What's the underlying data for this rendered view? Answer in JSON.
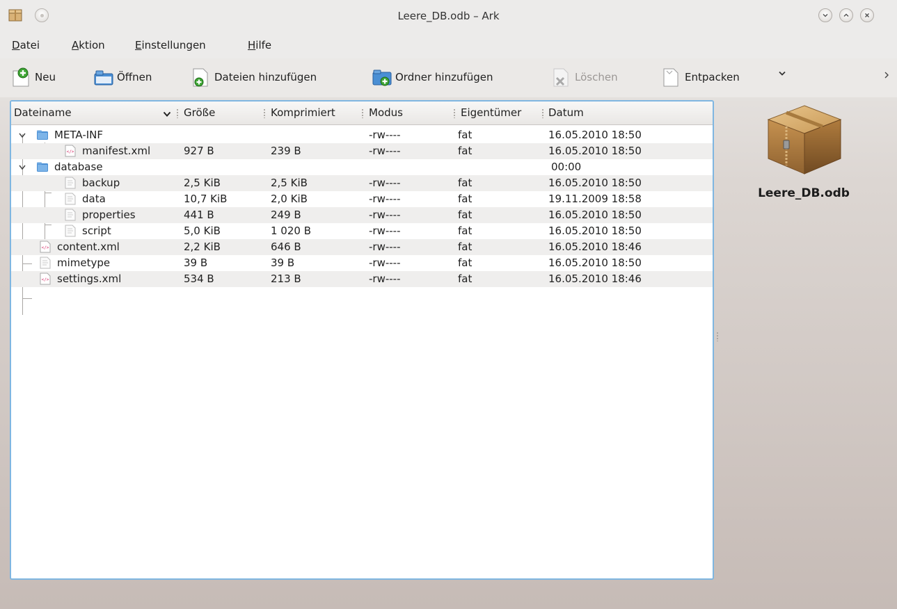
{
  "window": {
    "title": "Leere_DB.odb – Ark",
    "app_icon": "ark-archive-icon",
    "buttons": [
      "minimize-icon",
      "maximize-icon",
      "close-icon"
    ]
  },
  "menu": {
    "items": [
      {
        "pre": "",
        "ul": "D",
        "post": "atei"
      },
      {
        "pre": "",
        "ul": "A",
        "post": "ktion"
      },
      {
        "pre": "",
        "ul": "E",
        "post": "instellungen"
      },
      {
        "pre": "",
        "ul": "H",
        "post": "ilfe"
      }
    ]
  },
  "toolbar": {
    "new_label": "Neu",
    "open_label": "Öffnen",
    "add_files_label": "Dateien hinzufügen",
    "add_folder_label": "Ordner hinzufügen",
    "delete_label": "Löschen",
    "extract_label": "Entpacken",
    "more_icon": "chevron-right-icon"
  },
  "columns": {
    "name": "Dateiname",
    "size": "Größe",
    "compressed": "Komprimiert",
    "mode": "Modus",
    "owner": "Eigentümer",
    "date": "Datum"
  },
  "rows": [
    {
      "name": "META-INF",
      "size": "",
      "compressed": "",
      "mode": "-rw----",
      "owner": "fat",
      "date": "16.05.2010 18:50",
      "icon": "folder-icon"
    },
    {
      "name": "manifest.xml",
      "size": "927 B",
      "compressed": "239 B",
      "mode": "-rw----",
      "owner": "fat",
      "date": "16.05.2010 18:50",
      "icon": "xml-file-icon"
    },
    {
      "name": "database",
      "size": "",
      "compressed": "",
      "mode": "",
      "owner": "",
      "date": "00:00",
      "icon": "folder-icon"
    },
    {
      "name": "backup",
      "size": "2,5 KiB",
      "compressed": "2,5 KiB",
      "mode": "-rw----",
      "owner": "fat",
      "date": "16.05.2010 18:50",
      "icon": "text-file-icon"
    },
    {
      "name": "data",
      "size": "10,7 KiB",
      "compressed": "2,0 KiB",
      "mode": "-rw----",
      "owner": "fat",
      "date": "19.11.2009 18:58",
      "icon": "text-file-icon"
    },
    {
      "name": "properties",
      "size": "441 B",
      "compressed": "249 B",
      "mode": "-rw----",
      "owner": "fat",
      "date": "16.05.2010 18:50",
      "icon": "text-file-icon"
    },
    {
      "name": "script",
      "size": "5,0 KiB",
      "compressed": "1 020 B",
      "mode": "-rw----",
      "owner": "fat",
      "date": "16.05.2010 18:50",
      "icon": "text-file-icon"
    },
    {
      "name": "content.xml",
      "size": "2,2 KiB",
      "compressed": "646 B",
      "mode": "-rw----",
      "owner": "fat",
      "date": "16.05.2010 18:46",
      "icon": "xml-file-icon"
    },
    {
      "name": "mimetype",
      "size": "39 B",
      "compressed": "39 B",
      "mode": "-rw----",
      "owner": "fat",
      "date": "16.05.2010 18:50",
      "icon": "text-file-icon"
    },
    {
      "name": "settings.xml",
      "size": "534 B",
      "compressed": "213 B",
      "mode": "-rw----",
      "owner": "fat",
      "date": "16.05.2010 18:46",
      "icon": "xml-file-icon"
    }
  ],
  "preview": {
    "filename": "Leere_DB.odb",
    "icon": "archive-box-icon"
  },
  "colors": {
    "accent": "#7fb6e1",
    "folder": "#4a8fd4",
    "xml_tag": "#d6336c"
  }
}
